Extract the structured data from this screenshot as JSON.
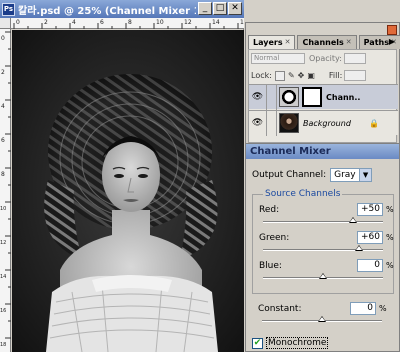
{
  "document": {
    "title": "칼라.psd @ 25% (Channel Mixer 1, Laye...",
    "icon": "photoshop-doc-icon",
    "buttons": {
      "minimize": "_",
      "maximize": "□",
      "close": "✕"
    },
    "rulers": {
      "top_ticks": [
        "0",
        "2",
        "4",
        "6",
        "8",
        "10",
        "12",
        "14",
        "16"
      ],
      "left_ticks": [
        "0",
        "2",
        "4",
        "6",
        "8",
        "10",
        "12",
        "14",
        "16",
        "18"
      ]
    }
  },
  "layers_panel": {
    "tabs": [
      {
        "label": "Layers",
        "active": true
      },
      {
        "label": "Channels",
        "active": false
      },
      {
        "label": "Paths",
        "active": false
      }
    ],
    "menu_icon": "▶",
    "blend_mode": "Normal",
    "opacity_label": "Opacity:",
    "lock_label": "Lock:",
    "fill_label": "Fill:",
    "layers": [
      {
        "name": "Chann...",
        "type": "adjustment",
        "visible": true,
        "selected": true
      },
      {
        "name": "Background",
        "type": "image",
        "visible": true,
        "locked": true
      }
    ]
  },
  "channel_mixer": {
    "title": "Channel Mixer",
    "output_channel_label": "Output Channel:",
    "output_channel_value": "Gray",
    "source_channels_label": "Source Channels",
    "channels": [
      {
        "label": "Red:",
        "value": "+50",
        "pct": "%",
        "fraction": 0.75
      },
      {
        "label": "Green:",
        "value": "+60",
        "pct": "%",
        "fraction": 0.8
      },
      {
        "label": "Blue:",
        "value": "0",
        "pct": "%",
        "fraction": 0.5
      }
    ],
    "constant": {
      "label": "Constant:",
      "value": "0",
      "pct": "%",
      "fraction": 0.5
    },
    "monochrome_label": "Monochrome",
    "monochrome_checked": true
  }
}
